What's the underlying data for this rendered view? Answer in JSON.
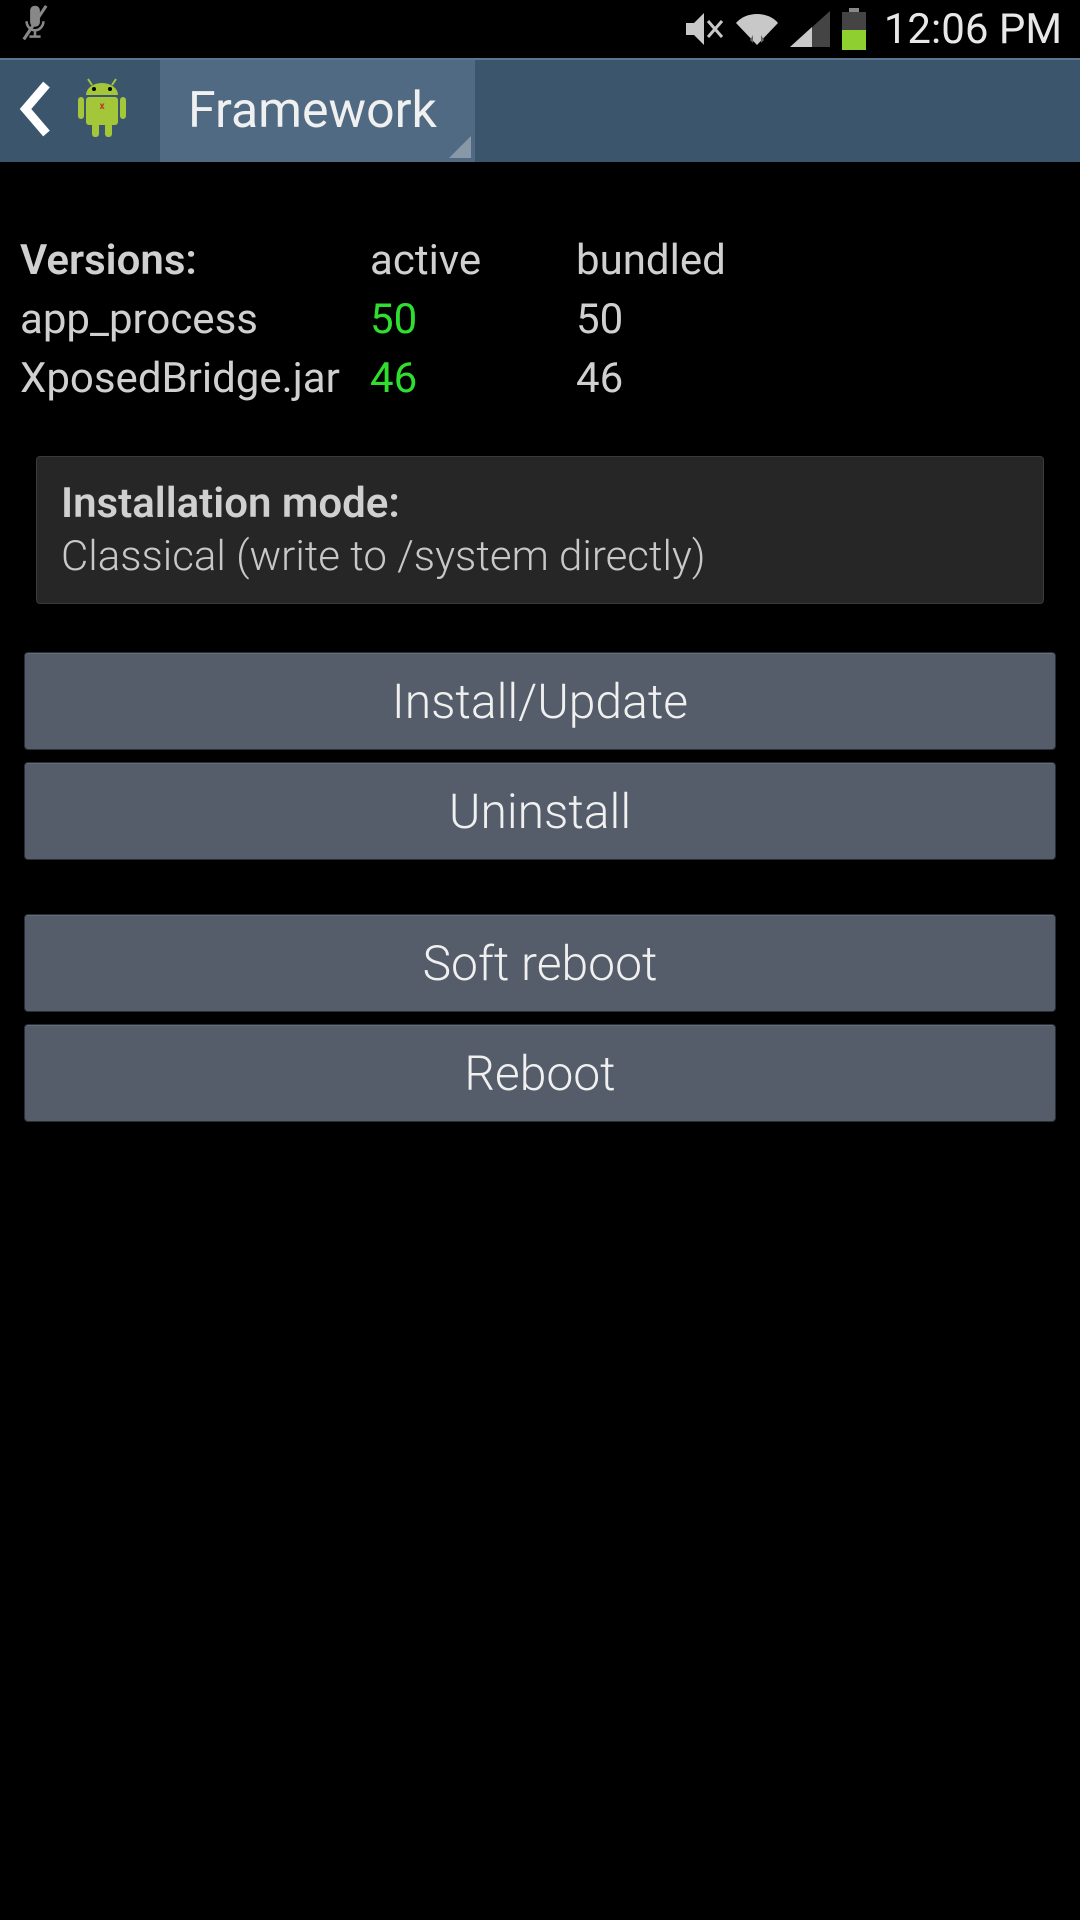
{
  "status": {
    "time": "12:06 PM"
  },
  "header": {
    "title": "Framework"
  },
  "versions": {
    "label": "Versions:",
    "col_active": "active",
    "col_bundled": "bundled",
    "rows": [
      {
        "name": "app_process",
        "active": "50",
        "bundled": "50"
      },
      {
        "name": "XposedBridge.jar",
        "active": "46",
        "bundled": "46"
      }
    ]
  },
  "install_mode": {
    "label": "Installation mode:",
    "value": "Classical (write to /system directly)"
  },
  "buttons": {
    "install": "Install/Update",
    "uninstall": "Uninstall",
    "soft_reboot": "Soft reboot",
    "reboot": "Reboot"
  }
}
